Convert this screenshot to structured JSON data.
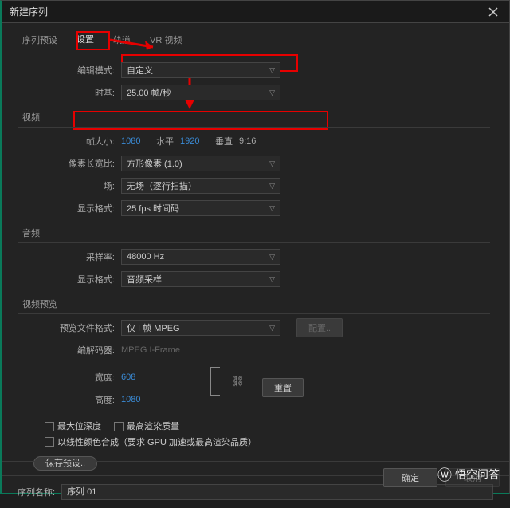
{
  "window": {
    "title": "新建序列"
  },
  "tabs": {
    "presets": "序列预设",
    "settings": "设置",
    "tracks": "轨道",
    "vr": "VR 视频"
  },
  "labels": {
    "edit_mode": "编辑模式:",
    "timebase": "时基:",
    "video_section": "视频",
    "frame_size": "帧大小:",
    "horizontal": "水平",
    "vertical": "垂直",
    "aspect_result": "9:16",
    "pixel_aspect": "像素长宽比:",
    "fields": "场:",
    "display_format": "显示格式:",
    "audio_section": "音频",
    "sample_rate": "采样率:",
    "audio_display_format": "显示格式:",
    "preview_section": "视频预览",
    "preview_file_format": "预览文件格式:",
    "codec": "编解码器:",
    "width": "宽度:",
    "height": "高度:",
    "max_bit_depth": "最大位深度",
    "max_render_quality": "最高渲染质量",
    "gpu_composite": "以线性颜色合成（要求 GPU 加速或最高渲染品质）",
    "save_preset": "保存预设..",
    "sequence_name": "序列名称:",
    "configure": "配置..",
    "reset": "重置",
    "ok": "确定",
    "cancel": "取消"
  },
  "values": {
    "edit_mode": "自定义",
    "timebase": "25.00 帧/秒",
    "frame_width": "1080",
    "frame_height": "1920",
    "pixel_aspect": "方形像素 (1.0)",
    "fields": "无场（逐行扫描）",
    "display_format": "25 fps 时间码",
    "sample_rate": "48000 Hz",
    "audio_display_format": "音频采样",
    "preview_file_format": "仅 I 帧 MPEG",
    "codec": "MPEG I-Frame",
    "preview_width": "608",
    "preview_height": "1080",
    "sequence_name": "序列 01"
  },
  "watermark": "悟空问答"
}
